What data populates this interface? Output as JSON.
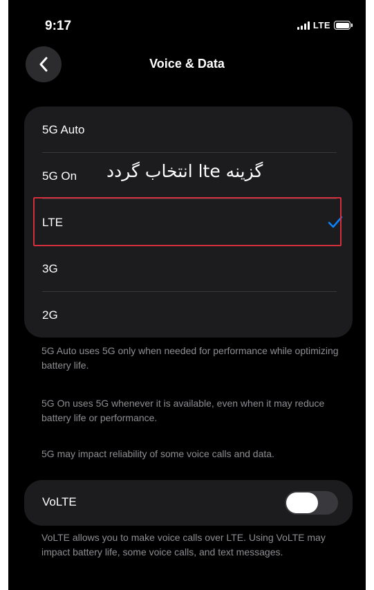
{
  "status_bar": {
    "time": "9:17",
    "network": "LTE"
  },
  "nav": {
    "title": "Voice & Data",
    "back_icon": "chevron-left-icon"
  },
  "network_options": [
    {
      "label": "5G Auto",
      "selected": false
    },
    {
      "label": "5G On",
      "selected": false
    },
    {
      "label": "LTE",
      "selected": true
    },
    {
      "label": "3G",
      "selected": false
    },
    {
      "label": "2G",
      "selected": false
    }
  ],
  "annotation": {
    "text": "گزینه lte انتخاب گردد",
    "highlight_color": "#d32f3c"
  },
  "footnotes": [
    "5G Auto uses 5G only when needed for performance while optimizing battery life.",
    "5G On uses 5G whenever it is available, even when it may reduce battery life or performance.",
    "5G may impact reliability of some voice calls and data."
  ],
  "volte": {
    "label": "VoLTE",
    "enabled": false,
    "description": "VoLTE allows you to make voice calls over LTE. Using VoLTE may impact battery life, some voice calls, and text messages."
  },
  "colors": {
    "background": "#000000",
    "group_background": "#1c1c1e",
    "accent": "#0a84ff",
    "secondary_text": "#8e8e93"
  }
}
